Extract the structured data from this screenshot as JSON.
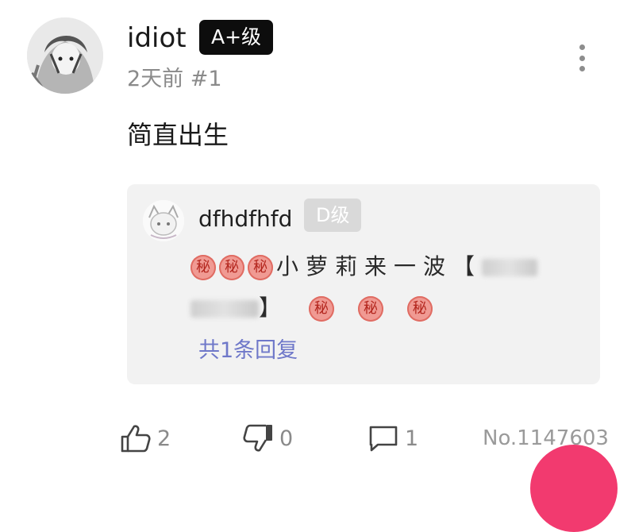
{
  "comment": {
    "username": "idiot",
    "level_badge": "A+级",
    "time": "2天前",
    "floor": "#1",
    "text": "简直出生"
  },
  "reply": {
    "username": "dfhdfhfd",
    "level_badge": "D级",
    "emoji": "秘",
    "text_middle": "小萝莉来一波【",
    "text_close": "】",
    "count_label": "共1条回复"
  },
  "actions": {
    "likes": "2",
    "dislikes": "0",
    "comments": "1",
    "post_number": "No.1147603"
  },
  "icons": {
    "like": "thumbs-up-icon",
    "dislike": "thumbs-down-icon",
    "comment": "comment-icon",
    "more": "more-vertical-icon"
  },
  "colors": {
    "badge_primary": "#0d0d0d",
    "badge_secondary": "#d9d9d9",
    "link": "#6f78c9",
    "fab": "#f23a6f",
    "emoji": "#f09a93"
  }
}
